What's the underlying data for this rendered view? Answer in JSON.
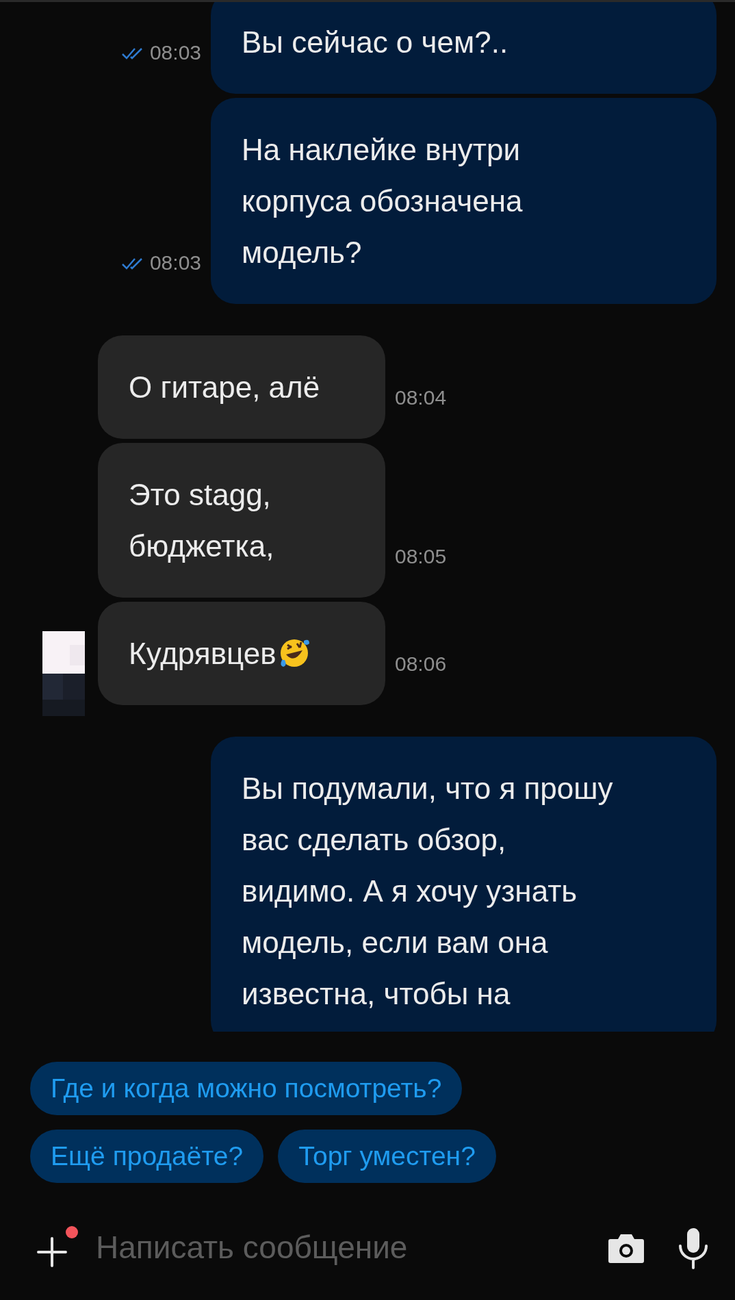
{
  "messages": [
    {
      "kind": "outgoing",
      "lines": [
        "Вы сейчас о чем?.."
      ],
      "time": "08:03",
      "read": true
    },
    {
      "kind": "outgoing",
      "lines": [
        "На наклейке внутри",
        "корпуса обозначена",
        "модель?"
      ],
      "time": "08:03",
      "read": true
    },
    {
      "kind": "incoming",
      "lines": [
        "О гитаре, алё"
      ],
      "time": "08:04",
      "avatar": false
    },
    {
      "kind": "incoming",
      "lines": [
        "Это stagg,",
        "бюджетка,"
      ],
      "time": "08:05",
      "avatar": false
    },
    {
      "kind": "incoming",
      "lines": [
        "Кудрявцев"
      ],
      "trailing_icon": {
        "kind": "laughing-emoji"
      },
      "time": "08:06",
      "avatar": true
    },
    {
      "kind": "outgoing",
      "lines": [
        "Вы подумали, что я прошу",
        "вас сделать обзор,",
        "видимо. А я хочу узнать",
        "модель, если вам она",
        "известна, чтобы на"
      ]
    }
  ],
  "quick_replies": [
    [
      "Где и когда можно посмотреть?"
    ],
    [
      "Ещё продаёте?",
      "Торг уместен?"
    ]
  ],
  "composer": {
    "placeholder": "Написать сообщение",
    "attach_badge": true
  }
}
